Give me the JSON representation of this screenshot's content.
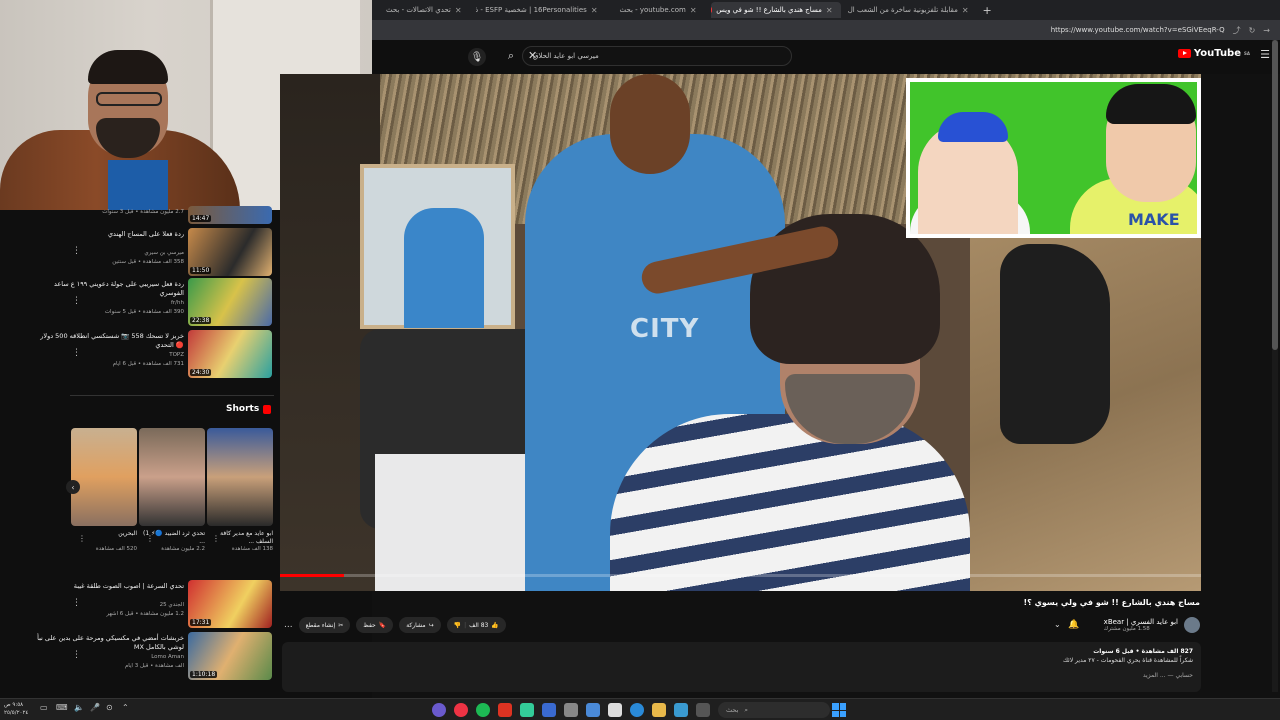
{
  "browser": {
    "tabs": [
      {
        "label": "تحدي الاتصالات - بحث",
        "active": false
      },
      {
        "label": "16Personalities | شخصية ESFP - ذالجن",
        "active": false
      },
      {
        "label": "youtube.com - بحث",
        "active": false
      },
      {
        "label": "مساج هندي بالشارع !! شو في ويس",
        "active": true
      },
      {
        "label": "مقابلة تلفزيونية ساخرة من الشعب ال",
        "active": false
      }
    ],
    "new_tab": "+",
    "url": "https://www.youtube.com/watch?v=eSGiVEeqR-Q"
  },
  "youtube": {
    "logo": "YouTube",
    "logo_suffix": "SA",
    "search_value": "ميرسي ابو عايد الحلاق"
  },
  "sidebar": {
    "recommendations": [
      {
        "title": "ردة فعلا على المساج الهندي",
        "channel": "ميرسي بن سيري",
        "meta": "358 الف مشاهدة • قبل سنتين",
        "duration": "11:50"
      },
      {
        "title": "ردة فعل سيريبي على جولة دعويني ١٩٩ ع ساعد الفوسري",
        "channel": "fr/hh",
        "meta": "390 الف مشاهدة • قبل 5 سنوات",
        "duration": "22:38"
      },
      {
        "title": "خربز لا تسحك 558 📷 شستكسي انطلاقه 500 دولار 🔴 التحدي",
        "channel": "TOPZ",
        "meta": "731 الف مشاهدة • قبل 6 ايام",
        "duration": "24:30"
      }
    ],
    "top_partial": "2.7 مليون مشاهدة • قبل 3 سنوات",
    "top_duration": "14:47",
    "shorts_title": "Shorts",
    "shorts": [
      {
        "title": "ابو عايد مع مدير كافة السلف ...",
        "views": "138 الف مشاهدة"
      },
      {
        "title": "تحدي ثرد الضبيد 🔵⚡ 1) ...",
        "views": "2.2 مليون مشاهدة"
      },
      {
        "title": "البحرين",
        "views": "520 الف مشاهدة"
      }
    ],
    "more_recs": [
      {
        "title": "تحدي السرعة | اصوب الصوت طلقة غيبة",
        "channel": "الجندي 25",
        "meta": "1.2 مليون مشاهدة • قبل 6 اشهر",
        "duration": "17:31"
      },
      {
        "title": "خربشات أمضي في مكسيكي ومرحة على بدين على نبأ لوشي بالكامل MX",
        "channel": "Lomo Aman",
        "meta": "الف مشاهدة • قبل 3 ايام",
        "duration": "1:10:18"
      }
    ]
  },
  "video": {
    "progress_percent": 7,
    "title": "مساج هندي بالشارع !! شو في ولي يسوي ؟!",
    "channel_name": "ابو عايد الفسري | xBear",
    "channel_subs": "1.58 مليون مشترك",
    "likes": "83 الف",
    "share_label": "مشاركة",
    "save_label": "حفظ",
    "clip_label": "إنشاء مقطع",
    "more_label": "...",
    "description_stats": "827 الف مشاهدة • قبل 6 سنوات",
    "description_line": "شكراً للمشاهدة قناة بحري الفحومات - ٢٧ مدير لائك",
    "description_more": "... المزيد",
    "description_side": "حسابي"
  },
  "taskbar": {
    "search_placeholder": "بحث",
    "time": "٩:٥٨ ص",
    "date": "٢٥/٥/٢٠٢٤"
  }
}
